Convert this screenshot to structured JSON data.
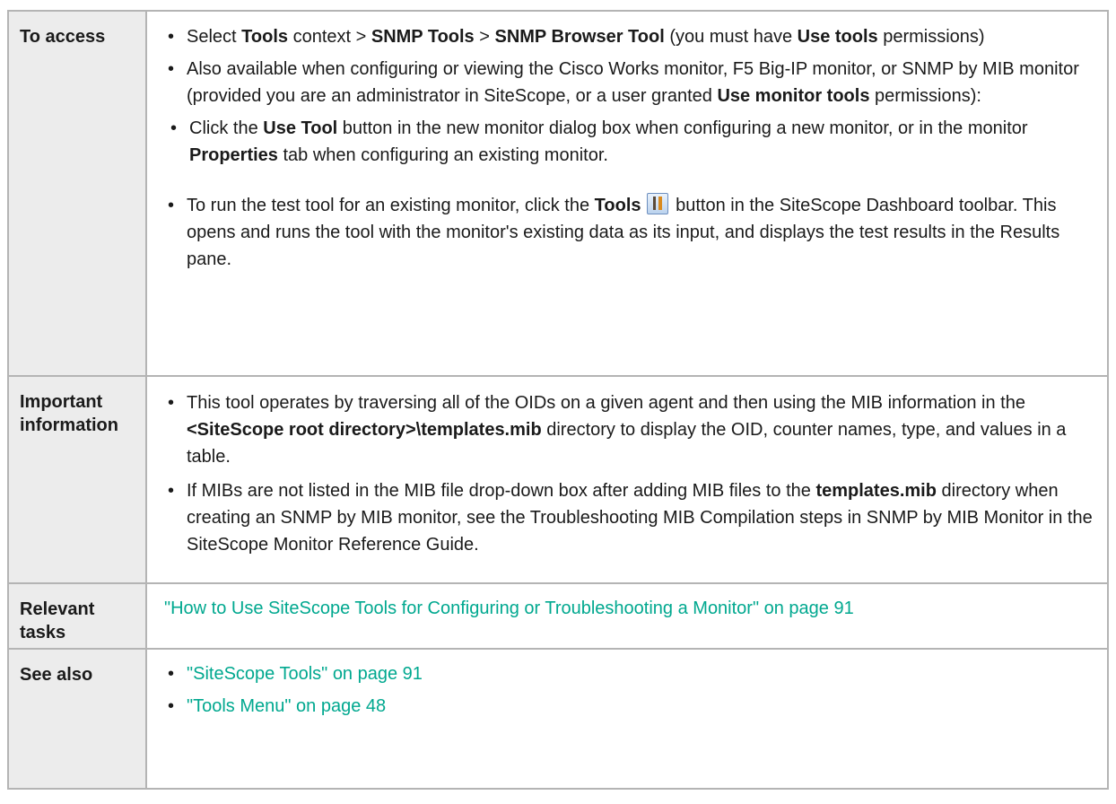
{
  "rows": {
    "access": {
      "label": "To access",
      "b1": {
        "t1": "Select ",
        "b1": "Tools",
        "t2": " context > ",
        "b2": "SNMP Tools",
        "t3": " > ",
        "b3": "SNMP Browser Tool",
        "t4": " (you must have ",
        "b4": "Use tools",
        "t5": " permissions)"
      },
      "b2": {
        "t1": "Also available when configuring or viewing the Cisco Works monitor, F5 Big-IP monitor, or SNMP by MIB monitor (provided you are an administrator in SiteScope, or a user granted ",
        "b1": "Use monitor tools",
        "t2": " permissions):"
      },
      "b3": {
        "t1": "Click the ",
        "b1": "Use Tool",
        "t2": " button in the new monitor dialog box when configuring a new monitor, or in the monitor ",
        "b2": "Properties",
        "t3": " tab when configuring an existing monitor."
      },
      "b4": {
        "t1": "To run the test tool for an existing monitor, click the ",
        "b1": "Tools",
        "t2": " button in the SiteScope Dashboard toolbar. This opens and runs the tool with the monitor's existing data as its input, and displays the test results in the Results pane.",
        "icon": "tools-icon"
      }
    },
    "important": {
      "label": "Important information",
      "b1": {
        "t1": "This tool operates by traversing all of the OIDs on a given agent and then using the MIB information in the ",
        "b1": "<SiteScope root directory>\\templates.mib",
        "t2": " directory to display the OID, counter names, type, and values in a table."
      },
      "b2": {
        "t1": "If MIBs are not listed in the MIB file drop-down box after adding MIB files to the ",
        "b1": "templates.mib",
        "t2": " directory when creating an SNMP by MIB monitor, see the Troubleshooting MIB Compilation steps in SNMP by MIB Monitor in the SiteScope Monitor Reference Guide."
      }
    },
    "tasks": {
      "label": "Relevant tasks",
      "link": "\"How to Use SiteScope Tools for Configuring or Troubleshooting a Monitor\" on page 91"
    },
    "see_also": {
      "label": "See also",
      "links": [
        "\"SiteScope Tools\" on page 91",
        "\"Tools Menu\" on page 48"
      ]
    }
  },
  "colors": {
    "link": "#00a88f",
    "label_bg": "#ececec",
    "border": "#b4b4b4"
  }
}
